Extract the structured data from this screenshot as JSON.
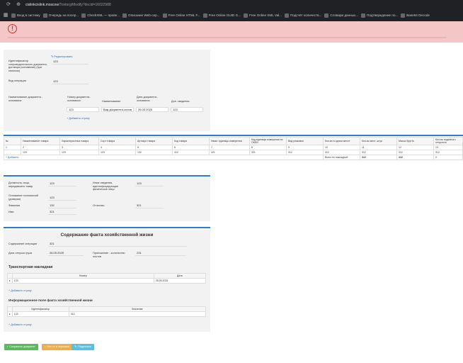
{
  "browser": {
    "url_host": "cislinkcislink.moscow",
    "url_path": "/Tovtorg/Modify?docid=16022988",
    "bookmarks": [
      "Вход в систему",
      "Очередь на посер...",
      "CheckXML — прове...",
      "Описание Web-сер...",
      "Free Online HTML F...",
      "Free Online GUID G...",
      "Free Online XML Val...",
      "Подсчёт количеств...",
      "Словари данных...",
      "Подтверждение по...",
      "Base64 Decode"
    ]
  },
  "header": {
    "edit_link": "Редактировать",
    "id_label": "Идентификатор сопроводительного документа, договора (основание) (при наличии)",
    "id_value": "123",
    "op_type_label": "Вид операции",
    "op_type_value": "123",
    "basis_label": "Наименование документа - основание",
    "doc_num_header": "Номер документа-основания",
    "doc_name_header": "Наименование",
    "doc_date_header": "Дата документа - основания",
    "doc_extra_header": "Доп. сведения",
    "doc_num": "123",
    "doc_name": "Вид документа-основ",
    "doc_date": "26.05.2025",
    "doc_extra": "123",
    "add_row": "Добавить строку"
  },
  "goods": {
    "columns": [
      "№",
      "Наименование товара",
      "Характеристика товара",
      "Сорт товара",
      "Артикул товара",
      "Код товара",
      "Наим. единицы измерения",
      "Код единицы измерения по ОКЕИ",
      "Вид упаковки",
      "Кол-во в одном месте",
      "Кол-во мест, штук",
      "Масса брутто",
      "Кол-во поданного отпустить"
    ],
    "numbers": [
      "1",
      "2",
      "3",
      "4",
      "5",
      "6",
      "7",
      "8",
      "9",
      "10",
      "11",
      "12",
      "13"
    ],
    "row": [
      "",
      "123",
      "123",
      "123",
      "132",
      "312",
      "321",
      "321",
      "312",
      "312",
      "312",
      "312",
      "312"
    ],
    "add": "Добавить",
    "total_label": "Всего по накладной",
    "total_a": "312",
    "total_b": "312",
    "total_c": "0"
  },
  "persons": {
    "pos_label": "Должность лица, передавшего товар",
    "pos_value": "123",
    "other_label": "Иные сведения, идентифицирующие физическое лицо",
    "other_value": "123",
    "auth_label": "Основание полномочий (доверия)",
    "auth_value": "123",
    "last_label": "Фамилия",
    "last_value": "132",
    "patr_label": "Отчество",
    "patr_value": "321",
    "first_label": "Имя",
    "first_value": "321"
  },
  "fact": {
    "title": "Содержание факта хозяйственной жизни",
    "content_label": "Содержание операции",
    "content_value": "321",
    "date_label": "Дата отпуска груза",
    "date_value": "26.05.2025",
    "appendix_label": "Приложение - количество листов",
    "appendix_value": "231"
  },
  "transport": {
    "title": "Транспортная накладная",
    "col_num": "Номер",
    "col_date": "Дата",
    "num": "123",
    "date": "26.05.2025",
    "add": "Добавить строку"
  },
  "info": {
    "title": "Информационное поле факта хозяйственной жизни",
    "col_id": "Идентификатор",
    "col_val": "Значение",
    "id": "123",
    "val": "312",
    "add": "Добавить строку"
  },
  "actions": {
    "save": "Сохранить документ",
    "draft": "Что-то в черновик",
    "send": "Подписать"
  },
  "colors": {
    "accent": "#2a7dd3",
    "alert_bg": "#f4c6c6",
    "save": "#5cb85c",
    "draft": "#f0ad4e",
    "send": "#5bc0de"
  }
}
